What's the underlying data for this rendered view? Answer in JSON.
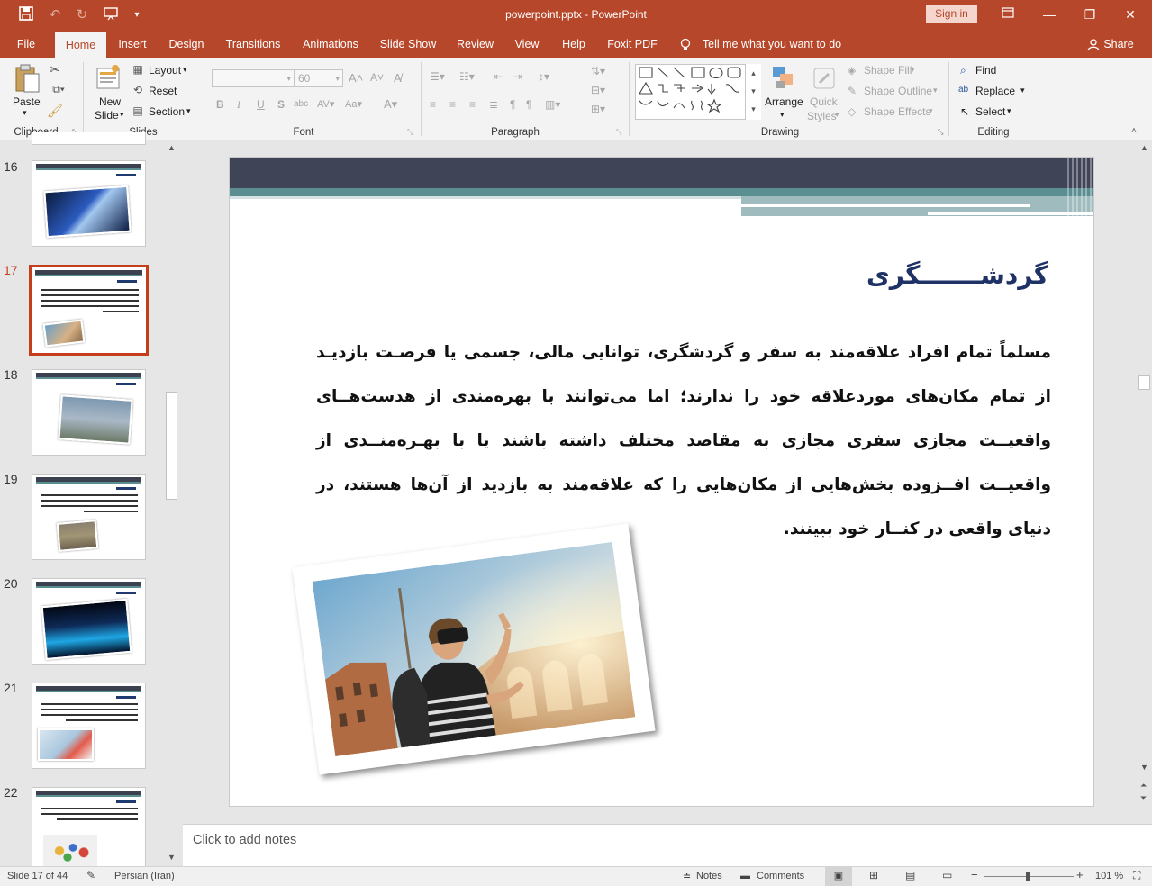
{
  "window": {
    "title": "powerpoint.pptx  -  PowerPoint",
    "sign_in": "Sign in"
  },
  "tabs": [
    "File",
    "Home",
    "Insert",
    "Design",
    "Transitions",
    "Animations",
    "Slide Show",
    "Review",
    "View",
    "Help",
    "Foxit PDF"
  ],
  "tell_me": "Tell me what you want to do",
  "share": "Share",
  "ribbon": {
    "clipboard": {
      "label": "Clipboard",
      "paste": "Paste"
    },
    "slides": {
      "label": "Slides",
      "new_slide_1": "New",
      "new_slide_2": "Slide",
      "layout": "Layout",
      "reset": "Reset",
      "section": "Section"
    },
    "font": {
      "label": "Font",
      "size": "60"
    },
    "paragraph": {
      "label": "Paragraph"
    },
    "drawing": {
      "label": "Drawing",
      "arrange": "Arrange",
      "quick_styles_1": "Quick",
      "quick_styles_2": "Styles",
      "shape_fill": "Shape Fill",
      "shape_outline": "Shape Outline",
      "shape_effects": "Shape Effects"
    },
    "editing": {
      "label": "Editing",
      "find": "Find",
      "replace": "Replace",
      "select": "Select"
    }
  },
  "thumbnails": [
    {
      "num": "16",
      "selected": false
    },
    {
      "num": "17",
      "selected": true
    },
    {
      "num": "18",
      "selected": false
    },
    {
      "num": "19",
      "selected": false
    },
    {
      "num": "20",
      "selected": false
    },
    {
      "num": "21",
      "selected": false
    },
    {
      "num": "22",
      "selected": false
    }
  ],
  "slide": {
    "title": "گردشـــــــگری",
    "body": "مسلماً تمام افراد علاقه‌مند به سفر و گردشگری، توانایی مالی، جسمی یا فرصـت بازدیـد از تمام مکان‌های موردعلاقه خود را ندارند؛ اما می‌توانند با بهره‌مندی از هدست‌هــای واقعیــت مجازی سفری مجازی به مقاصد مختلف داشته باشند یا با بهـره‌منــدی از واقعیــت افــزوده بخش‌هایی از مکان‌هایی را که علاقه‌مند به بازدید از آن‌ها هستند، در دنیای واقعی در کنــار خود ببینند."
  },
  "notes_placeholder": "Click to add notes",
  "status": {
    "slide_count": "Slide 17 of 44",
    "language": "Persian (Iran)",
    "notes": "Notes",
    "comments": "Comments",
    "zoom": "101 %"
  },
  "colors": {
    "accent": "#b7472a",
    "selected_thumb": "#c43e1c",
    "slide_title": "#1f3266",
    "slide_header_dark": "#3f4456",
    "slide_header_teal": "#5a8e91"
  }
}
